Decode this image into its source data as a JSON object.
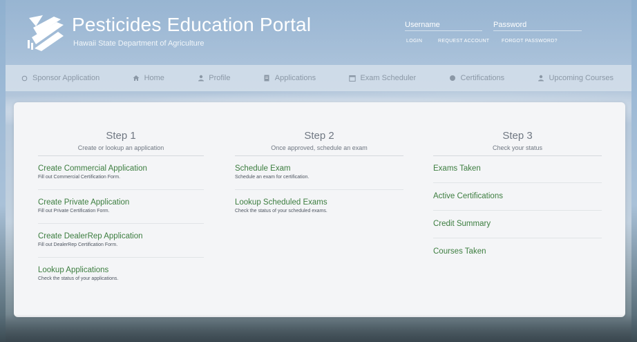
{
  "header": {
    "title": "Pesticides Education Portal",
    "subtitle": "Hawaii State Department of Agriculture",
    "login": {
      "username_label": "Username",
      "password_label": "Password",
      "login_link": "LOGIN",
      "request_link": "REQUEST ACCOUNT",
      "forgot_link": "FORGOT PASSWORD?"
    }
  },
  "nav": {
    "items": [
      {
        "label": "Sponsor Application",
        "icon": "circle-outline-icon"
      },
      {
        "label": "Home",
        "icon": "home-icon"
      },
      {
        "label": "Profile",
        "icon": "user-icon"
      },
      {
        "label": "Applications",
        "icon": "document-icon"
      },
      {
        "label": "Exam Scheduler",
        "icon": "calendar-icon"
      },
      {
        "label": "Certifications",
        "icon": "badge-icon"
      },
      {
        "label": "Upcoming Courses",
        "icon": "users-icon"
      }
    ]
  },
  "steps": [
    {
      "title": "Step 1",
      "desc": "Create or lookup an application",
      "links": [
        {
          "title": "Create Commercial Application",
          "desc": "Fill out Commercial Certification Form."
        },
        {
          "title": "Create Private Application",
          "desc": "Fill out Private Certification Form."
        },
        {
          "title": "Create DealerRep Application",
          "desc": "Fill out DealerRep Certification Form."
        },
        {
          "title": "Lookup Applications",
          "desc": "Check the status of your applications."
        }
      ]
    },
    {
      "title": "Step 2",
      "desc": "Once approved, schedule an exam",
      "links": [
        {
          "title": "Schedule Exam",
          "desc": "Schedule an exam for certification."
        },
        {
          "title": "Lookup Scheduled Exams",
          "desc": "Check the status of your scheduled exams."
        }
      ]
    },
    {
      "title": "Step 3",
      "desc": "Check your status",
      "links": [
        {
          "title": "Exams Taken"
        },
        {
          "title": "Active Certifications"
        },
        {
          "title": "Credit Summary"
        },
        {
          "title": "Courses Taken"
        }
      ]
    }
  ],
  "colors": {
    "link_green": "#3c7d3f",
    "nav_text": "#8b98a6",
    "card_bg": "#f4f5f7"
  }
}
